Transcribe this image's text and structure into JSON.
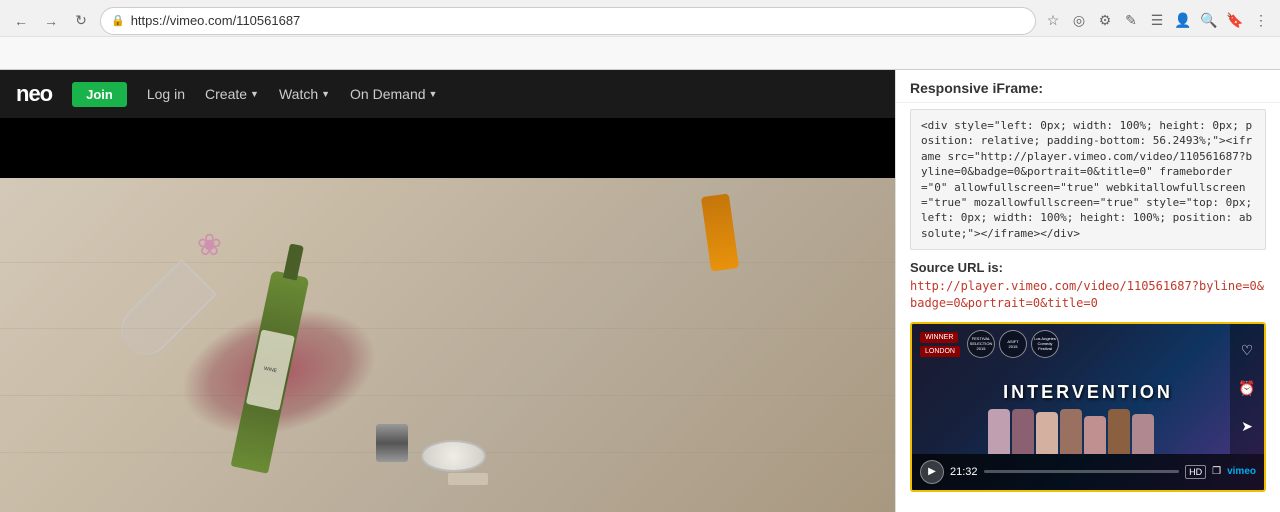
{
  "browser": {
    "url": "https://vimeo.com/110561687",
    "nav_buttons": [
      "←",
      "→",
      "↺"
    ],
    "toolbar_items": []
  },
  "vimeo": {
    "logo_prefix": "neo",
    "join_label": "Join",
    "nav_links": [
      {
        "label": "Log in"
      },
      {
        "label": "Create",
        "has_chevron": true
      },
      {
        "label": "Watch",
        "has_chevron": true
      },
      {
        "label": "On Demand",
        "has_chevron": true
      }
    ]
  },
  "right_panel": {
    "title": "Responsive iFrame:",
    "code_snippet": "<div style=\"left: 0px; width: 100%; height: 0px; position: relative; padding-bottom: 56.2493%;\"><iframe src=\"http://player.vimeo.com/video/110561687?byline=0&badge=0&portrait=0&title=0\" frameborder=\"0\" allowfullscreen=\"true\" webkitallowfullscreen=\"true\" mozallowfullscreen=\"true\" style=\"top: 0px; left: 0px; width: 100%; height: 100%; position: absolute;\"></iframe></div>",
    "source_url_label": "Source URL is:",
    "source_url": "http://player.vimeo.com/video/110561687?byline=0&badge=0&portrait=0&title=0",
    "video": {
      "title": "INTERVENTION",
      "duration": "21:32",
      "winner_label": "WINNER",
      "festival_label": "LONDON",
      "hd_label": "HD",
      "vimeo_label": "vimeo"
    }
  }
}
